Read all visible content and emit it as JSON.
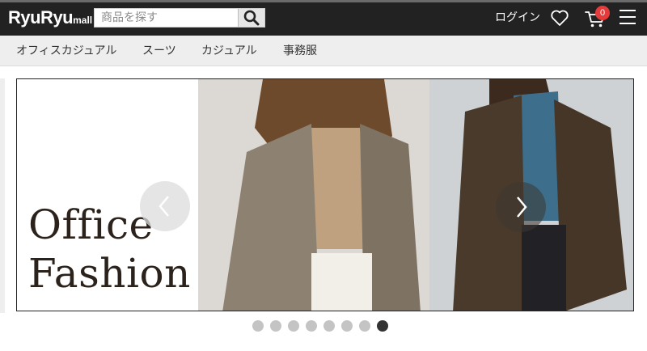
{
  "header": {
    "logo_main": "RyuRyu",
    "logo_sub": "mall",
    "search_placeholder": "商品を探す",
    "login_label": "ログイン",
    "cart_count": "0",
    "colors": {
      "bar": "#222222",
      "badge": "#e63b3b"
    }
  },
  "nav": {
    "categories": [
      "オフィスカジュアル",
      "スーツ",
      "カジュアル",
      "事務服"
    ]
  },
  "banner": {
    "line1": "Office",
    "line2": "Fashion",
    "slide_count": 8,
    "active_slide": 8
  },
  "icons": {
    "search": "search-icon",
    "favorites": "heart-icon",
    "cart": "cart-icon",
    "menu": "hamburger-menu-icon",
    "prev": "chevron-left-icon",
    "next": "chevron-right-icon"
  }
}
